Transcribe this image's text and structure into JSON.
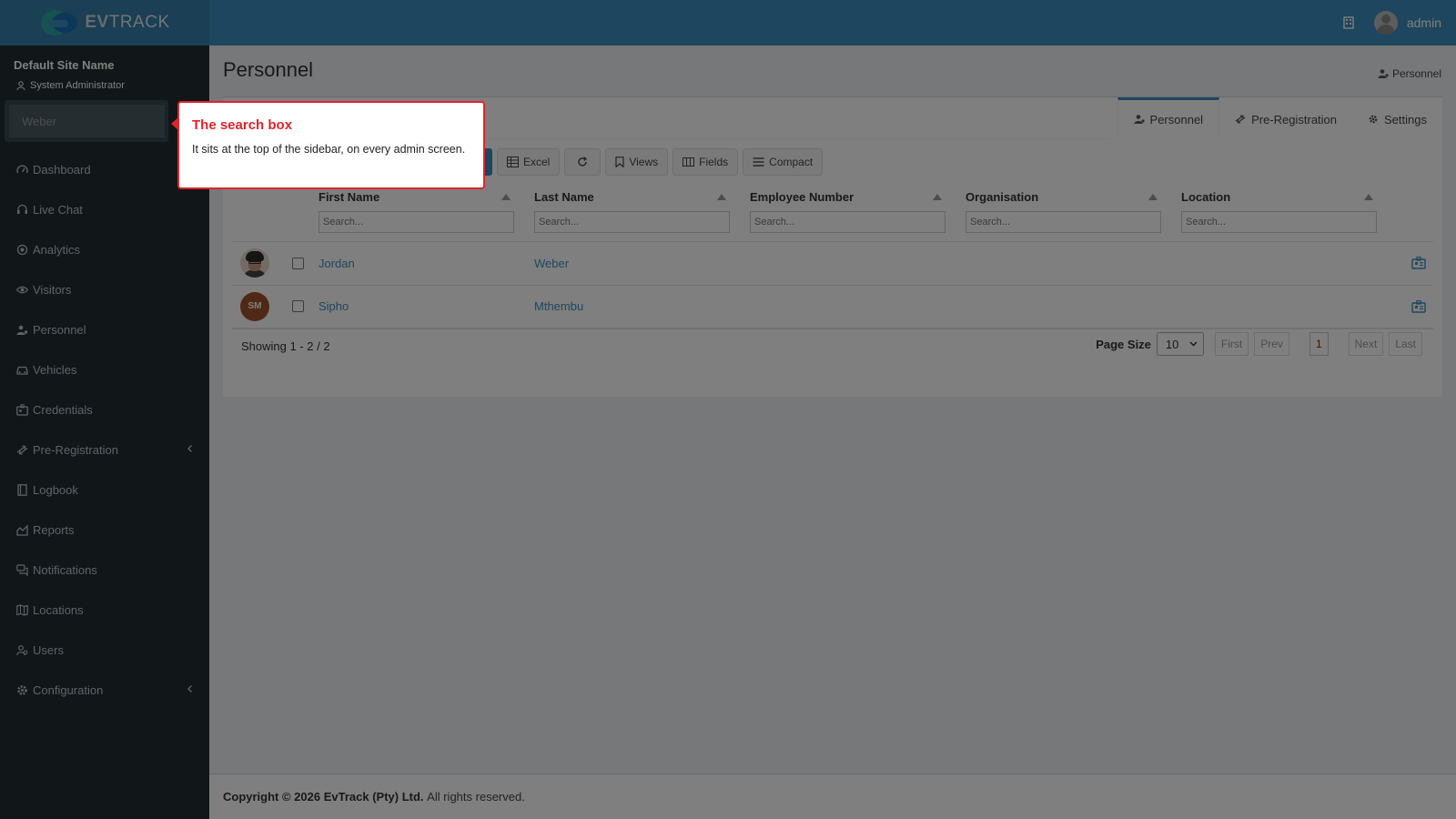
{
  "header": {
    "logo_text_bold": "EV",
    "logo_text": "TRACK",
    "user_name": "admin"
  },
  "sidebar": {
    "site_name": "Default Site Name",
    "role": "System Administrator",
    "search_value": "Weber",
    "items": [
      {
        "label": "Dashboard",
        "icon": "dashboard-icon"
      },
      {
        "label": "Live Chat",
        "icon": "headset-icon"
      },
      {
        "label": "Analytics",
        "icon": "target-icon"
      },
      {
        "label": "Visitors",
        "icon": "eye-icon"
      },
      {
        "label": "Personnel",
        "icon": "user-gear-icon"
      },
      {
        "label": "Vehicles",
        "icon": "car-icon"
      },
      {
        "label": "Credentials",
        "icon": "id-card-icon"
      },
      {
        "label": "Pre-Registration",
        "icon": "arrows-icon",
        "expandable": true
      },
      {
        "label": "Logbook",
        "icon": "book-icon"
      },
      {
        "label": "Reports",
        "icon": "chart-icon"
      },
      {
        "label": "Notifications",
        "icon": "comments-icon"
      },
      {
        "label": "Locations",
        "icon": "map-icon"
      },
      {
        "label": "Users",
        "icon": "users-icon"
      },
      {
        "label": "Configuration",
        "icon": "gear-icon",
        "expandable": true
      }
    ]
  },
  "page": {
    "title": "Personnel",
    "breadcrumb": "Personnel"
  },
  "tabs": [
    {
      "label": "Personnel",
      "active": true
    },
    {
      "label": "Pre-Registration",
      "active": false
    },
    {
      "label": "Settings",
      "active": false
    }
  ],
  "toolbar": {
    "excel": "Excel",
    "views": "Views",
    "fields": "Fields",
    "compact": "Compact"
  },
  "grid": {
    "columns": [
      "First Name",
      "Last Name",
      "Employee Number",
      "Organisation",
      "Location"
    ],
    "filter_placeholder": "Search...",
    "rows": [
      {
        "avatar": "photo",
        "initials": "",
        "first_name": "Jordan",
        "last_name": "Weber",
        "employee_number": "",
        "organisation": "",
        "location": ""
      },
      {
        "avatar": "initials",
        "initials": "SM",
        "first_name": "Sipho",
        "last_name": "Mthembu",
        "employee_number": "",
        "organisation": "",
        "location": ""
      }
    ],
    "showing": "Showing 1 - 2 / 2",
    "page_size_label": "Page Size",
    "page_size": "10",
    "pager": {
      "first": "First",
      "prev": "Prev",
      "current": "1",
      "next": "Next",
      "last": "Last"
    }
  },
  "footer": {
    "copyright": "Copyright © 2026",
    "company": "EvTrack (Pty) Ltd.",
    "rights": "All rights reserved."
  },
  "callout": {
    "title": "The search box",
    "body": "It sits at the top of the sidebar, on every admin screen."
  },
  "colors": {
    "header": "#3c8dbc",
    "sidebar": "#222d32",
    "accent": "#3c8dbc",
    "callout_border": "#e0242a"
  }
}
